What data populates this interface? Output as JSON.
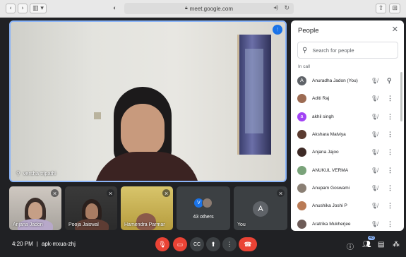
{
  "browser": {
    "url": "meet.google.com",
    "lock_icon": "lock-icon",
    "reload_icon": "reload-icon"
  },
  "main_speaker": {
    "name": "versha tripathi"
  },
  "tiles": [
    {
      "name": "Anjana Jadon"
    },
    {
      "name": "Pooja Jaiswal"
    },
    {
      "name": "Hamendra Parmar"
    },
    {
      "name": "43 others",
      "avatar_letter": "V"
    },
    {
      "name": "You",
      "avatar_letter": "A"
    }
  ],
  "people_panel": {
    "title": "People",
    "search_placeholder": "Search for people",
    "section_label": "In call",
    "participants": [
      {
        "name": "Anuradha Jadon (You)",
        "initial": "A",
        "color": "#5f6368"
      },
      {
        "name": "Aditi Raj",
        "initial": "",
        "color": "#9c6b53"
      },
      {
        "name": "akhil singh",
        "initial": "a",
        "color": "#a142f4"
      },
      {
        "name": "Akshara Malviya",
        "initial": "",
        "color": "#5b3b30"
      },
      {
        "name": "Anjana Jajoo",
        "initial": "",
        "color": "#3e2a26"
      },
      {
        "name": "ANUKUL VERMA",
        "initial": "",
        "color": "#7aa37a"
      },
      {
        "name": "Anupam Goswami",
        "initial": "",
        "color": "#8a7f74"
      },
      {
        "name": "Anushika Joshi P",
        "initial": "",
        "color": "#b97a55"
      },
      {
        "name": "Aratrika Mukherjee",
        "initial": "",
        "color": "#6d5b57"
      }
    ]
  },
  "bottom_bar": {
    "time": "4:20 PM",
    "separator": "|",
    "meeting_code": "apk-mxua-zhj",
    "participants_badge": "48"
  }
}
